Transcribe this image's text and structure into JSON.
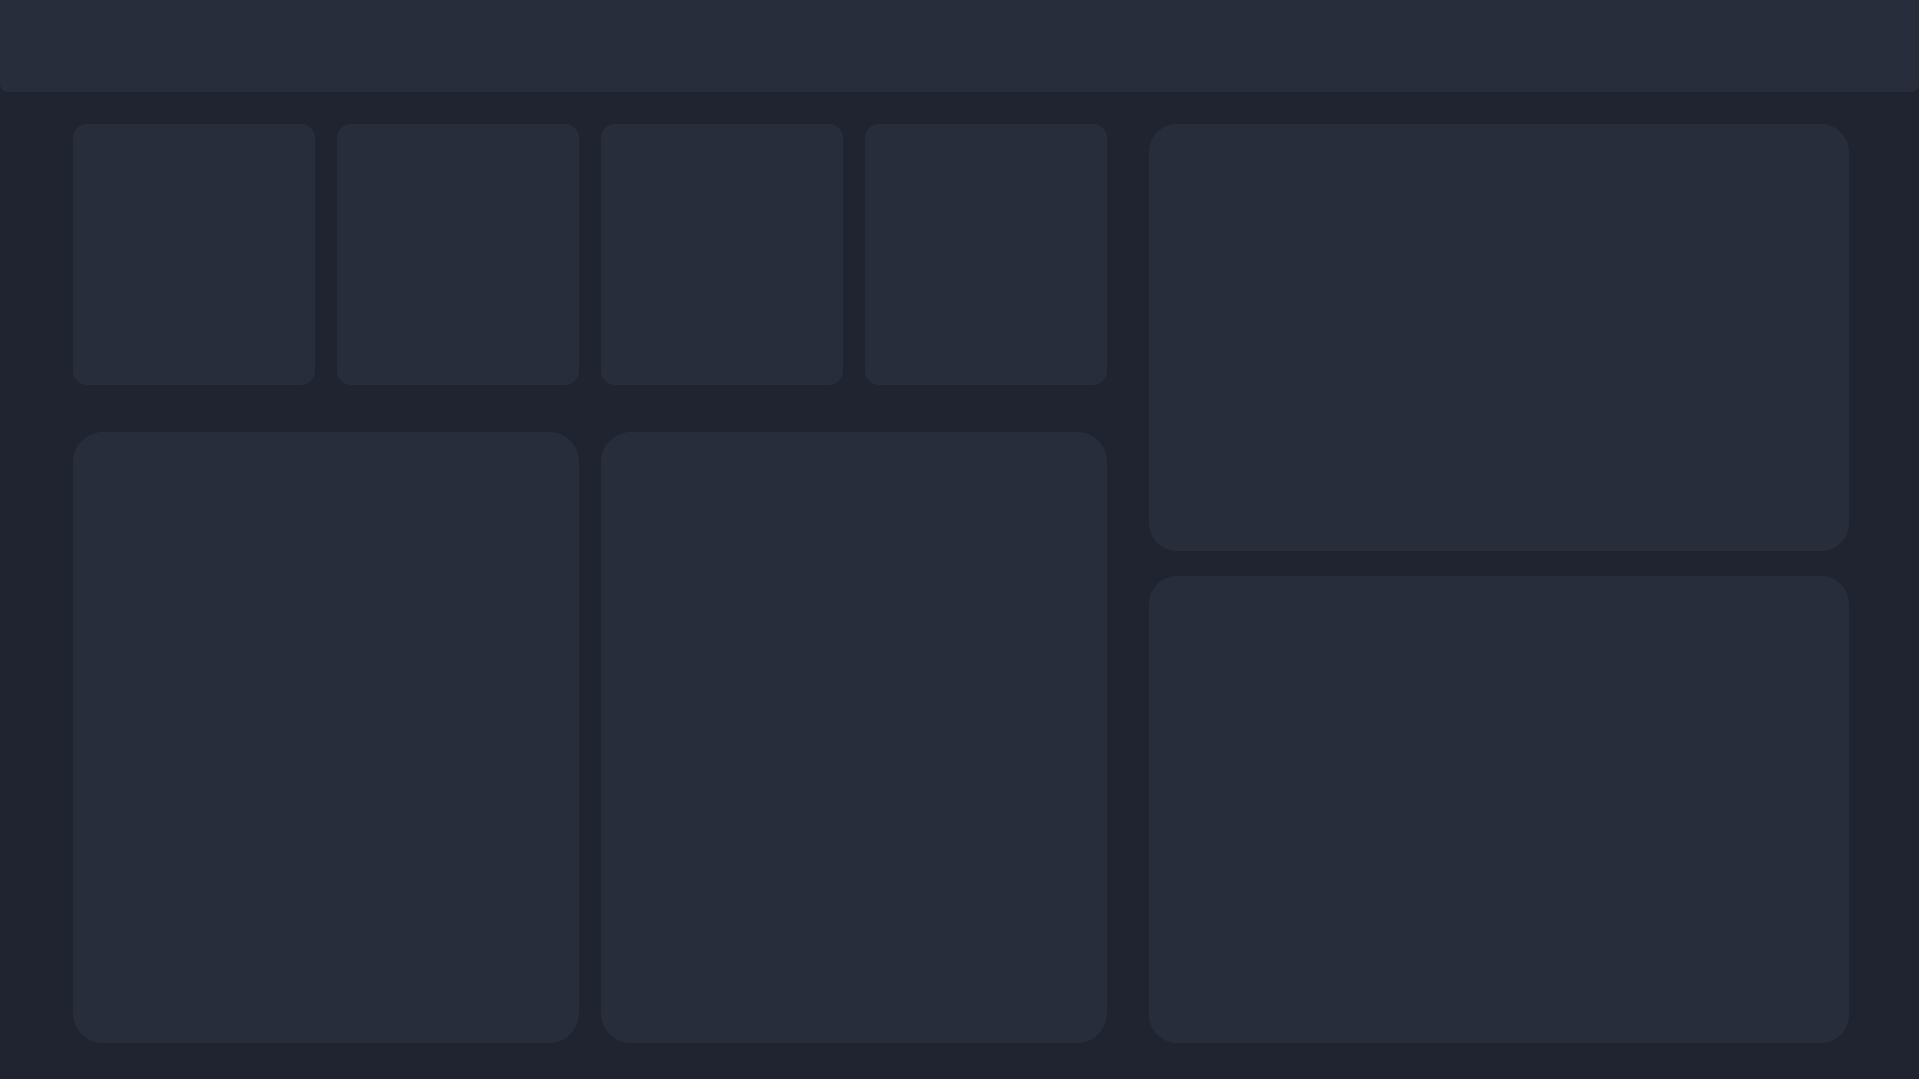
{
  "theme": {
    "background": "#1f2430",
    "surface": "#272d3b"
  },
  "top_bar": {},
  "stat_cards": [
    {},
    {},
    {},
    {}
  ],
  "panels": {
    "bottom_left": {},
    "bottom_middle": {},
    "right_top": {},
    "right_bottom": {}
  }
}
